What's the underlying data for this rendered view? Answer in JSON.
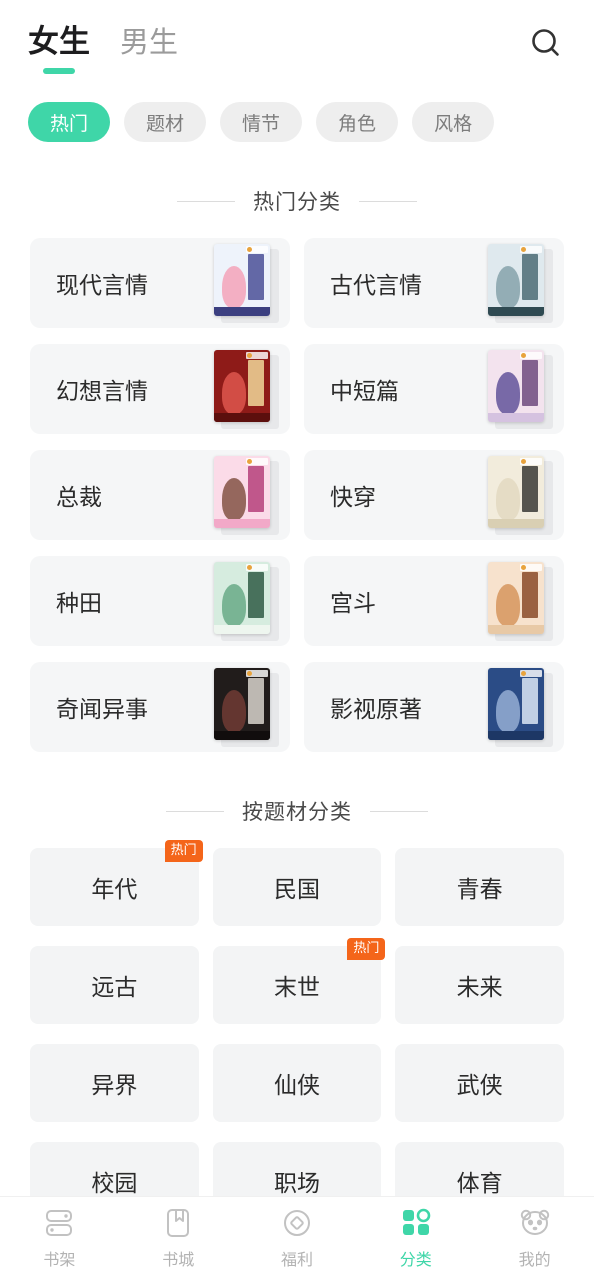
{
  "header": {
    "gender_tabs": [
      {
        "label": "女生",
        "active": true
      },
      {
        "label": "男生",
        "active": false
      }
    ],
    "search_icon": "search-icon"
  },
  "filters": [
    {
      "label": "热门",
      "active": true
    },
    {
      "label": "题材",
      "active": false
    },
    {
      "label": "情节",
      "active": false
    },
    {
      "label": "角色",
      "active": false
    },
    {
      "label": "风格",
      "active": false
    }
  ],
  "hot_section": {
    "title": "热门分类",
    "cards": [
      {
        "name": "现代言情",
        "cover": {
          "bg": "#eef3fb",
          "accent": "#4a4f96",
          "figure": "#f3a7bc",
          "foot": "#3b3f80"
        }
      },
      {
        "name": "古代言情",
        "cover": {
          "bg": "#dfe9ee",
          "accent": "#4c6b74",
          "figure": "#8ba6ae",
          "foot": "#2f4a52"
        }
      },
      {
        "name": "幻想言情",
        "cover": {
          "bg": "#8e1b18",
          "accent": "#f1d79a",
          "figure": "#d9534a",
          "foot": "#5c0f0d"
        }
      },
      {
        "name": "中短篇",
        "cover": {
          "bg": "#f3e3ee",
          "accent": "#6d4a7e",
          "figure": "#6a5b9e",
          "foot": "#d5c2e0"
        }
      },
      {
        "name": "总裁",
        "cover": {
          "bg": "#fbdbe8",
          "accent": "#b5407a",
          "figure": "#8a5a4e",
          "foot": "#f2a9c8"
        }
      },
      {
        "name": "快穿",
        "cover": {
          "bg": "#f2ecdc",
          "accent": "#3a3a35",
          "figure": "#e3dac2",
          "foot": "#d9cfb3"
        }
      },
      {
        "name": "种田",
        "cover": {
          "bg": "#d6ecdf",
          "accent": "#2f5c45",
          "figure": "#6fae8c",
          "foot": "#eef6ef"
        }
      },
      {
        "name": "宫斗",
        "cover": {
          "bg": "#f7e2cd",
          "accent": "#8a4a28",
          "figure": "#d79a64",
          "foot": "#e8c9a6"
        }
      },
      {
        "name": "奇闻异事",
        "cover": {
          "bg": "#211c1b",
          "accent": "#d8d3cd",
          "figure": "#6b3a33",
          "foot": "#110d0d"
        }
      },
      {
        "name": "影视原著",
        "cover": {
          "bg": "#2b4c86",
          "accent": "#dbe6f5",
          "figure": "#8fa9cf",
          "foot": "#1d3765"
        }
      }
    ]
  },
  "genre_section": {
    "title": "按题材分类",
    "tags": [
      {
        "label": "年代",
        "badge": "热门"
      },
      {
        "label": "民国",
        "badge": null
      },
      {
        "label": "青春",
        "badge": null
      },
      {
        "label": "远古",
        "badge": null
      },
      {
        "label": "末世",
        "badge": "热门"
      },
      {
        "label": "未来",
        "badge": null
      },
      {
        "label": "异界",
        "badge": null
      },
      {
        "label": "仙侠",
        "badge": null
      },
      {
        "label": "武侠",
        "badge": null
      },
      {
        "label": "校园",
        "badge": null
      },
      {
        "label": "职场",
        "badge": null
      },
      {
        "label": "体育",
        "badge": null
      }
    ]
  },
  "bottom_nav": [
    {
      "label": "书架",
      "icon": "bookshelf-icon",
      "active": false
    },
    {
      "label": "书城",
      "icon": "bookstore-icon",
      "active": false
    },
    {
      "label": "福利",
      "icon": "welfare-diamond-icon",
      "active": false
    },
    {
      "label": "分类",
      "icon": "category-grid-icon",
      "active": true
    },
    {
      "label": "我的",
      "icon": "panda-profile-icon",
      "active": false
    }
  ],
  "colors": {
    "accent_green": "#3fd6a8",
    "badge_orange": "#f4651a",
    "card_bg": "#f5f6f7",
    "tag_bg": "#f3f4f5",
    "text_dark": "#2b2b2b",
    "text_muted": "#9b9b9b"
  }
}
